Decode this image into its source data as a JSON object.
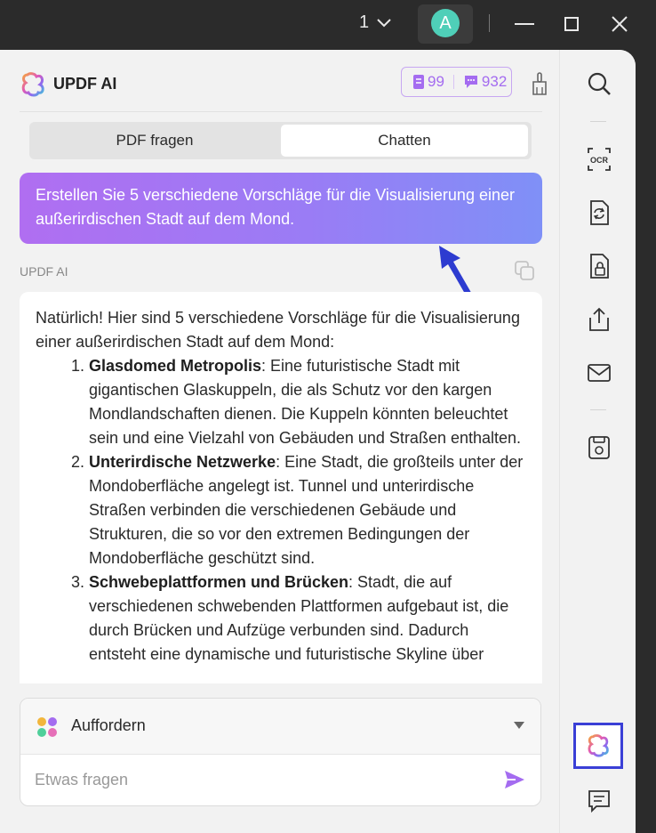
{
  "titlebar": {
    "page_number": "1",
    "avatar_letter": "A"
  },
  "header": {
    "brand": "UPDF AI",
    "quota_pdf": "99",
    "quota_chat": "932"
  },
  "tabs": {
    "pdf_label": "PDF fragen",
    "chat_label": "Chatten",
    "active": "Chatten"
  },
  "user_message": "Erstellen Sie 5 verschiedene Vorschläge für die Visualisierung einer außerirdischen Stadt auf dem Mond.",
  "ai_label": "UPDF AI",
  "answer": {
    "intro": "Natürlich! Hier sind 5 verschiedene Vorschläge für die Visualisierung einer außerirdischen Stadt auf dem Mond:",
    "items": [
      {
        "title": "Glasdomed Metropolis",
        "text": ": Eine futuristische Stadt mit gigantischen Glaskuppeln, die als Schutz vor den kargen Mondlandschaften dienen. Die Kuppeln könnten beleuchtet sein und eine Vielzahl von Gebäuden und Straßen enthalten."
      },
      {
        "title": "Unterirdische Netzwerke",
        "text": ": Eine Stadt, die großteils unter der Mondoberfläche angelegt ist. Tunnel und unterirdische Straßen verbinden die verschiedenen Gebäude und Strukturen, die so vor den extremen Bedingungen der Mondoberfläche geschützt sind."
      },
      {
        "title": "Schwebeplattformen und Brücken",
        "text": ": Stadt, die auf verschiedenen schwebenden Plattformen aufgebaut ist, die durch Brücken und Aufzüge verbunden sind. Dadurch entsteht eine dynamische und futuristische Skyline über"
      }
    ]
  },
  "input": {
    "prompt_label": "Auffordern",
    "placeholder": "Etwas fragen"
  },
  "colors": {
    "accent": "#a46cf0",
    "highlight_border": "#3a3fd6",
    "avatar": "#4fcfb8"
  }
}
